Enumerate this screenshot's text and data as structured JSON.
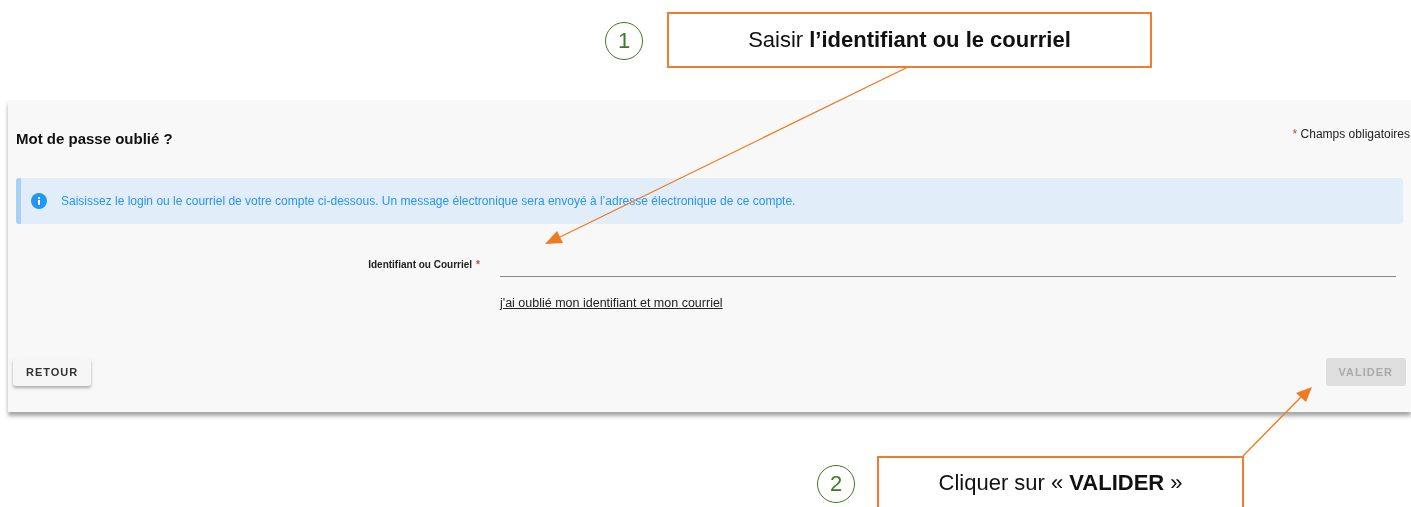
{
  "callouts": [
    {
      "number": "1",
      "text": "Saisir **l’identifiant ou le courriel**"
    },
    {
      "number": "2",
      "text": "Cliquer sur « **VALIDER** »"
    }
  ],
  "panel": {
    "title": "Mot de passe oublié ?",
    "required_note": {
      "mark": "*",
      "text": "Champs obligatoires"
    },
    "info": "Saisissez le login ou le courriel de votre compte ci-dessous. Un message électronique sera envoyé à l’adresse électronique de ce compte.",
    "field": {
      "label": "Identifiant ou Courriel",
      "required": true
    },
    "link": "j'ai oublié mon identifiant et mon courriel",
    "buttons": [
      {
        "label": "RETOUR",
        "disabled": false
      },
      {
        "label": "VALIDER",
        "disabled": true
      }
    ]
  }
}
